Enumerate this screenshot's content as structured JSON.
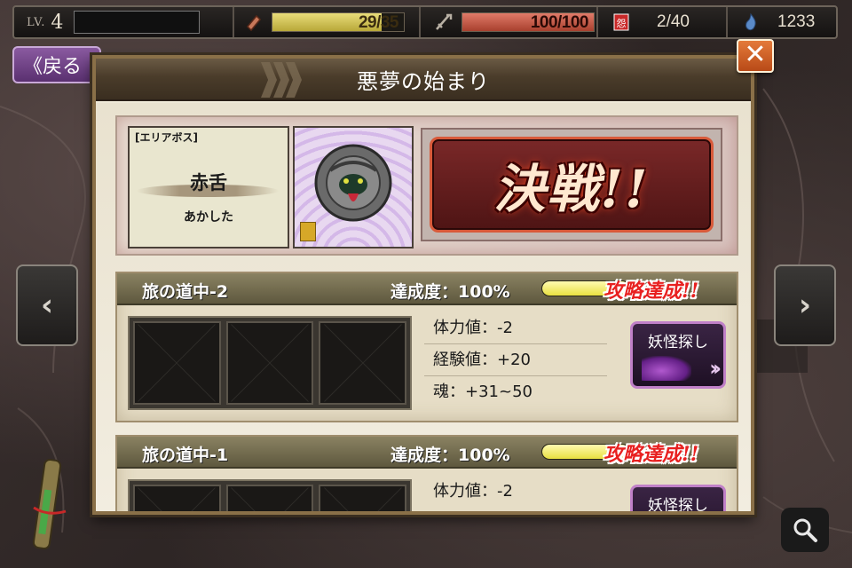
{
  "status_bar": {
    "level_label": "LV.",
    "level_value": "4",
    "stamina_text": "29/35",
    "stamina_fill": 0.83,
    "hp_text": "100/100",
    "hp_fill": 1.0,
    "deck_text": "2/40",
    "soul_text": "1233"
  },
  "nav": {
    "back_label": "《戻る",
    "prev_arrow": "‹",
    "next_arrow": "›"
  },
  "modal": {
    "title": "悪夢の始まり",
    "close_label": "✕",
    "boss": {
      "tag": "[エリアボス]",
      "name": "赤舌",
      "reading": "あかした",
      "battle_label": "決戦!!"
    },
    "stages": [
      {
        "name": "旅の道中-2",
        "progress_label": "達成度：100%",
        "progress": 1.0,
        "clear_label": "攻略達成!!",
        "stats": [
          "体力値：-2",
          "経験値：+20",
          "魂：+31~50"
        ],
        "action_label": "妖怪探し"
      },
      {
        "name": "旅の道中-1",
        "progress_label": "達成度：100%",
        "progress": 1.0,
        "clear_label": "攻略達成!!",
        "stats": [
          "体力値：-2"
        ],
        "action_label": "妖怪探し"
      }
    ]
  },
  "colors": {
    "stamina_gauge": "#c8b848",
    "hp_gauge": "#c85a4a",
    "accent_purple": "#c080c8",
    "battle_red": "#7a2828"
  },
  "icons": [
    "level-icon",
    "stamina-icon",
    "hp-icon",
    "deck-icon",
    "soul-icon",
    "search-icon"
  ]
}
